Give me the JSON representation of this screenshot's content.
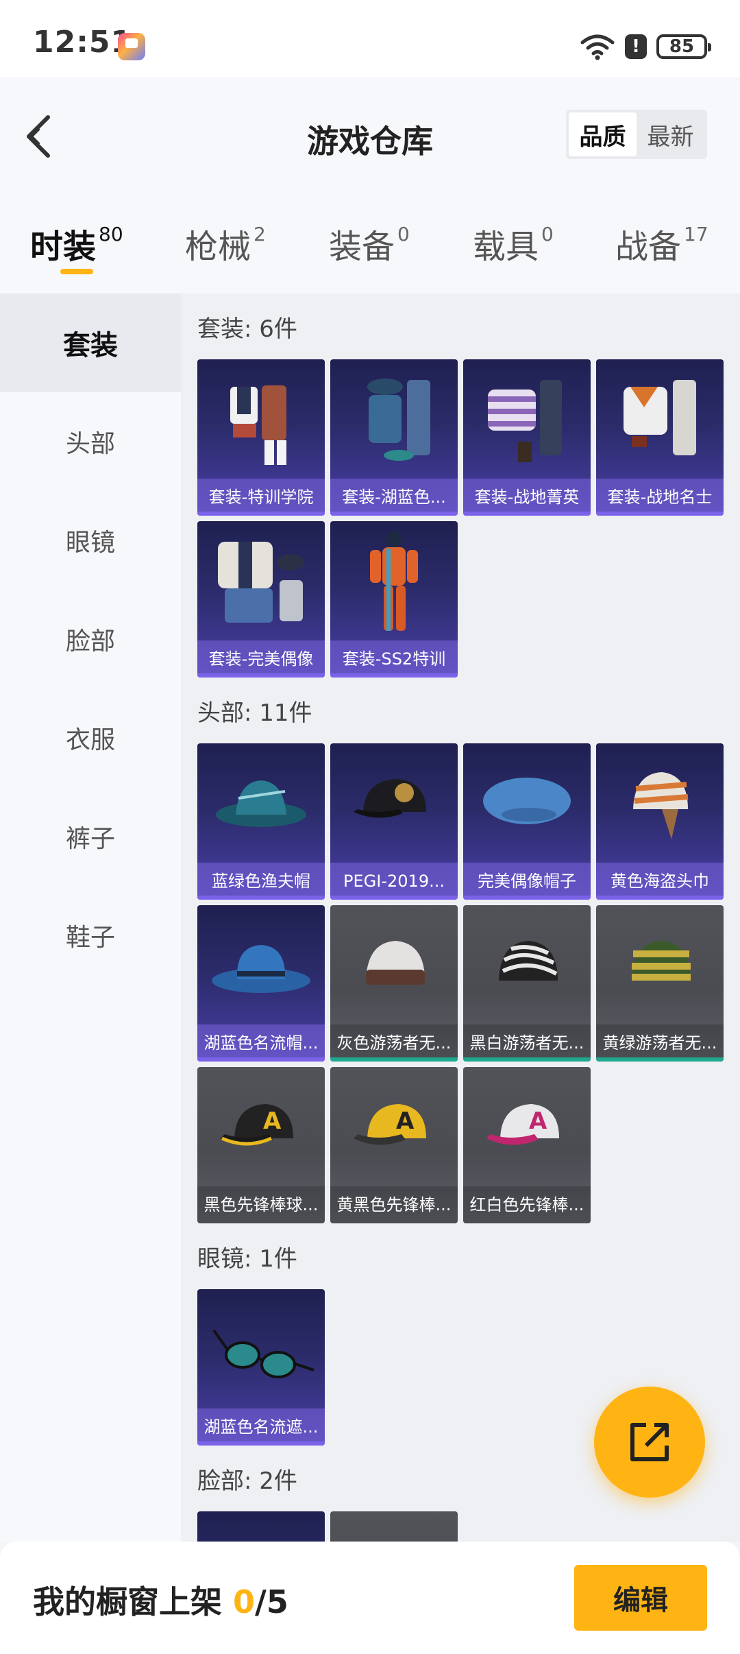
{
  "status_bar": {
    "time": "12:51",
    "battery": "85",
    "alert": "!"
  },
  "header": {
    "title": "游戏仓库",
    "sort_options": [
      "品质",
      "最新"
    ],
    "selected_sort": "品质"
  },
  "tabs": [
    {
      "label": "时装",
      "count": "80"
    },
    {
      "label": "枪械",
      "count": "2"
    },
    {
      "label": "装备",
      "count": "0"
    },
    {
      "label": "载具",
      "count": "0"
    },
    {
      "label": "战备",
      "count": "17"
    }
  ],
  "sidebar": {
    "items": [
      "套装",
      "头部",
      "眼镜",
      "脸部",
      "衣服",
      "裤子",
      "鞋子"
    ],
    "selected": "套装"
  },
  "sections": [
    {
      "title": "套装: 6件",
      "items": [
        "套装-特训学院",
        "套装-湖蓝色...",
        "套装-战地菁英",
        "套装-战地名士",
        "套装-完美偶像",
        "套装-SS2特训"
      ]
    },
    {
      "title": "头部: 11件",
      "items": [
        "蓝绿色渔夫帽",
        "PEGI-2019...",
        "完美偶像帽子",
        "黄色海盗头巾",
        "湖蓝色名流帽...",
        "灰色游荡者无...",
        "黑白游荡者无...",
        "黄绿游荡者无...",
        "黑色先锋棒球...",
        "黄黑色先锋棒...",
        "红白色先锋棒..."
      ]
    },
    {
      "title": "眼镜: 1件",
      "items": [
        "湖蓝色名流遮..."
      ]
    },
    {
      "title": "脸部: 2件",
      "items": []
    }
  ],
  "bottom_bar": {
    "label": "我的橱窗上架 ",
    "count": "0",
    "total": "/5",
    "edit_label": "编辑"
  },
  "colors": {
    "accent": "#ffb413",
    "epic": "#4a3fa8",
    "rare": "#1ea88d"
  }
}
